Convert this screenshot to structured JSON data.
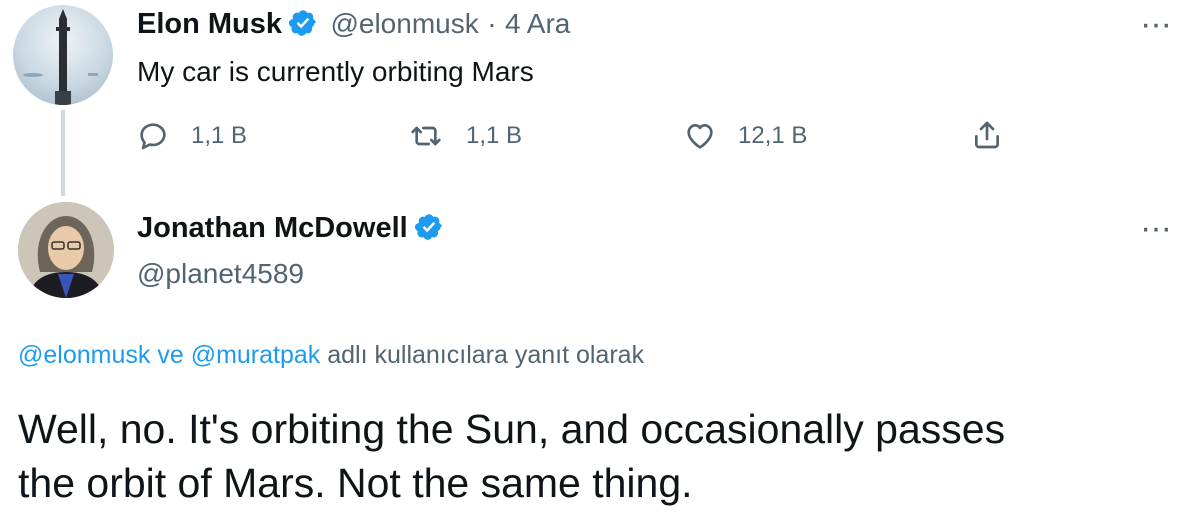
{
  "tweet1": {
    "name": "Elon Musk",
    "handle": "@elonmusk",
    "separator": "·",
    "date": "4 Ara",
    "text": "My car is currently orbiting Mars",
    "replies": "1,1 B",
    "retweets": "1,1 B",
    "likes": "12,1 B",
    "more": "···",
    "avatar_icon": "starship-avatar"
  },
  "tweet2": {
    "name": "Jonathan McDowell",
    "handle": "@planet4589",
    "more": "···",
    "reply_to": {
      "user1": "@elonmusk",
      "conj": "ve",
      "user2": "@muratpak",
      "suffix": "adlı kullanıcılara yanıt olarak"
    },
    "text_line1": "Well, no. It's orbiting the Sun, and occasionally passes",
    "text_line2": "the orbit of Mars. Not the same thing.",
    "avatar_icon": "person-avatar"
  },
  "colors": {
    "accent": "#1d9bf0",
    "secondary_text": "#536471",
    "primary_text": "#0f1419",
    "thread_line": "#cfd9de"
  }
}
